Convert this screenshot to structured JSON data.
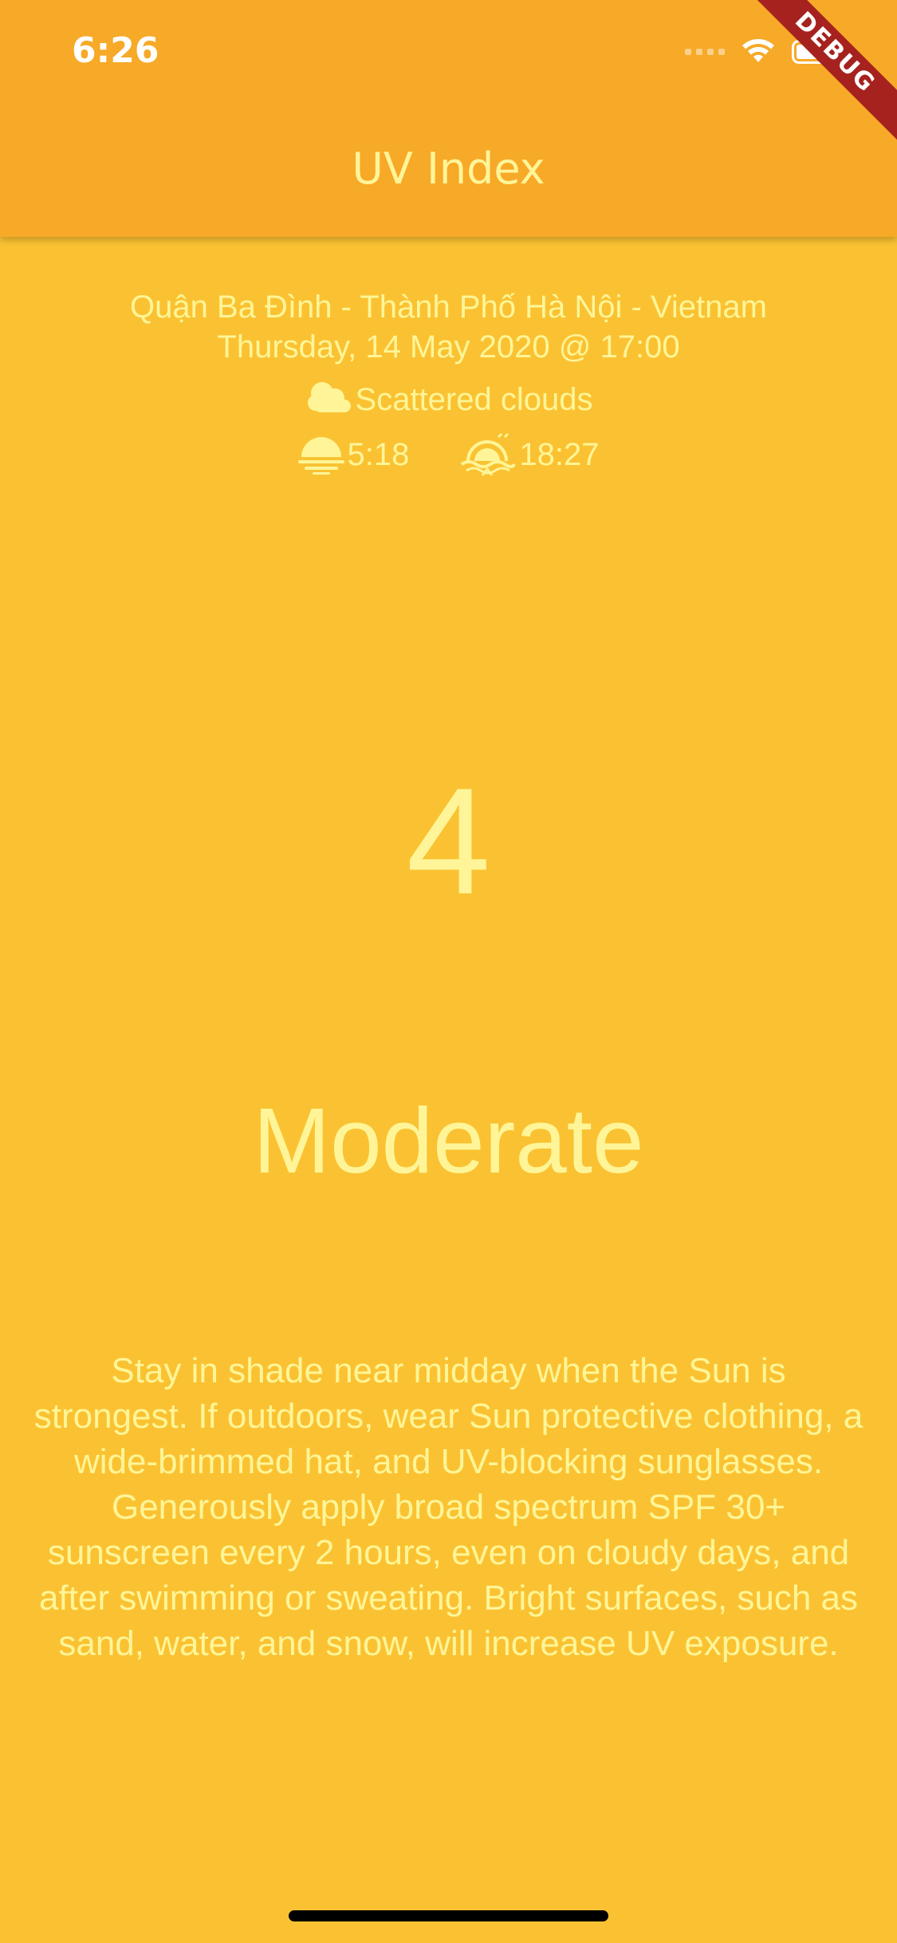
{
  "status_bar": {
    "time": "6:26"
  },
  "app_bar": {
    "title": "UV Index",
    "debug_label": "DEBUG"
  },
  "location": {
    "place": "Quận Ba Đình - Thành Phố Hà Nội - Vietnam",
    "datetime": "Thursday, 14 May 2020 @ 17:00"
  },
  "weather": {
    "icon": "cloud-icon",
    "description": "Scattered clouds",
    "sunrise_icon": "sunrise-icon",
    "sunrise": "5:18",
    "sunset_icon": "sunset-icon",
    "sunset": "18:27"
  },
  "uv": {
    "value": "4",
    "level": "Moderate",
    "advice": "Stay in shade near midday when the Sun is strongest. If outdoors, wear Sun protective clothing, a wide-brimmed hat, and UV-blocking sunglasses. Generously apply broad spectrum SPF 30+ sunscreen every 2 hours, even on cloudy days, and after swimming or sweating. Bright surfaces, such as sand, water, and snow, will increase UV exposure."
  },
  "colors": {
    "background": "#FAC232",
    "app_bar": "#F7A928",
    "text": "#FFF598",
    "debug_banner": "#A6221E"
  }
}
